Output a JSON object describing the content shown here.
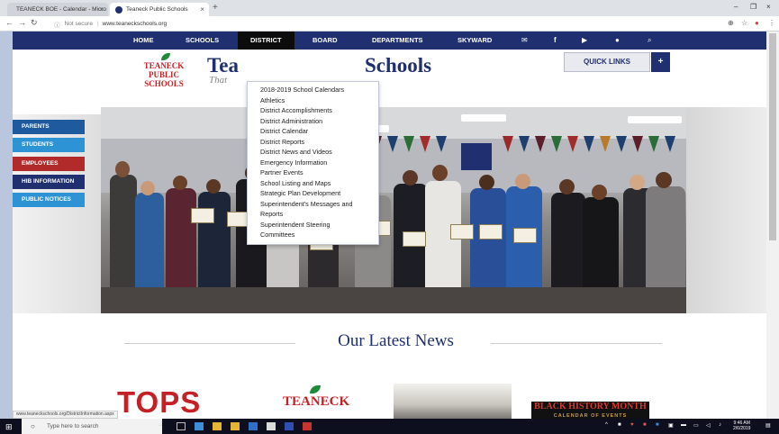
{
  "browser": {
    "tabs": [
      {
        "title": "TEANECK BOE - Calendar - Micro"
      },
      {
        "title": "Teaneck Public Schools"
      }
    ],
    "security_label": "Not secure",
    "url": "www.teaneckschools.org"
  },
  "nav": {
    "items": [
      "HOME",
      "SCHOOLS",
      "DISTRICT",
      "BOARD",
      "DEPARTMENTS",
      "SKYWARD"
    ],
    "icons": [
      "mail-icon",
      "facebook-icon",
      "youtube-icon",
      "flickr-icon",
      "search-icon"
    ]
  },
  "header": {
    "logo_words": [
      "TEANECK",
      "PUBLIC",
      "SCHOOLS"
    ],
    "title_left": "Tea",
    "title_right": "Schools",
    "tagline": "That",
    "quick_links": "QUICK LINKS",
    "quick_links_toggle": "+"
  },
  "sidebar": {
    "buttons": [
      {
        "label": "PARENTS",
        "color": "#1f5a9e"
      },
      {
        "label": "STUDENTS",
        "color": "#2e93d4"
      },
      {
        "label": "EMPLOYEES",
        "color": "#b12b2b"
      },
      {
        "label": "HIB INFORMATION",
        "color": "#1f2f6f"
      },
      {
        "label": "PUBLIC NOTICES",
        "color": "#2e93d4"
      }
    ]
  },
  "district_menu": {
    "items": [
      "2018-2019 School Calendars",
      "Athletics",
      "District Accomplishments",
      "District Administration",
      "District Calendar",
      "District Reports",
      "District News and Videos",
      "Emergency Information",
      "Partner Events",
      "School Listing and Maps",
      "Strategic Plan Development",
      "Superintendent's Messages and",
      "Reports",
      "Superintendent Steering",
      "Committees"
    ]
  },
  "main": {
    "section_title": "Our Latest News",
    "news": {
      "tops_logo": "TOPS",
      "teaneck_logo": "TEANECK",
      "bhm_title": "BLACK HISTORY MONTH",
      "bhm_sub": "CALENDAR OF EVENTS"
    }
  },
  "status_bar_url": "www.teaneckschools.org/DistrictInformation.aspx",
  "taskbar": {
    "search_placeholder": "Type here to search",
    "time": "9:46 AM",
    "date": "2/6/2019"
  },
  "colors": {
    "navy": "#1f2f6f",
    "red": "#c42127",
    "green": "#1f8a3a"
  }
}
